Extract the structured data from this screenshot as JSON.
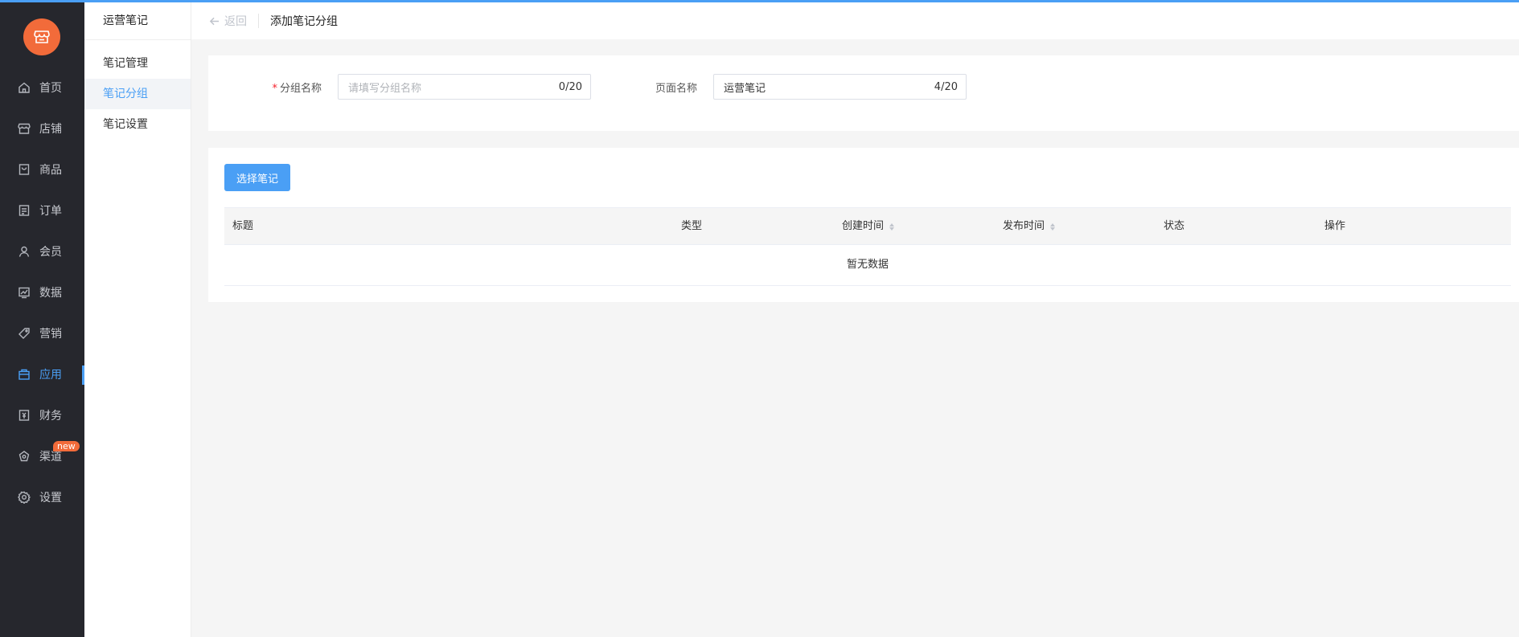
{
  "nav": {
    "items": [
      {
        "label": "首页",
        "icon": "home-icon"
      },
      {
        "label": "店铺",
        "icon": "store-icon"
      },
      {
        "label": "商品",
        "icon": "goods-icon"
      },
      {
        "label": "订单",
        "icon": "order-icon"
      },
      {
        "label": "会员",
        "icon": "member-icon"
      },
      {
        "label": "数据",
        "icon": "data-icon"
      },
      {
        "label": "营销",
        "icon": "tag-icon"
      },
      {
        "label": "应用",
        "icon": "app-icon",
        "active": true
      },
      {
        "label": "财务",
        "icon": "finance-icon"
      },
      {
        "label": "渠道",
        "icon": "channel-icon",
        "badge": "new"
      },
      {
        "label": "设置",
        "icon": "gear-icon"
      }
    ]
  },
  "subnav": {
    "title": "运营笔记",
    "items": [
      {
        "label": "笔记管理"
      },
      {
        "label": "笔记分组",
        "active": true
      },
      {
        "label": "笔记设置"
      }
    ]
  },
  "header": {
    "back_label": "返回",
    "title": "添加笔记分组"
  },
  "form": {
    "group_name": {
      "label": "分组名称",
      "required_mark": "*",
      "placeholder": "请填写分组名称",
      "value": "",
      "count": "0/20"
    },
    "page_name": {
      "label": "页面名称",
      "value": "运营笔记",
      "count": "4/20"
    }
  },
  "toolbar": {
    "select_notes_label": "选择笔记"
  },
  "table": {
    "columns": [
      {
        "label": "标题"
      },
      {
        "label": "类型"
      },
      {
        "label": "创建时间",
        "sortable": true
      },
      {
        "label": "发布时间",
        "sortable": true
      },
      {
        "label": "状态"
      },
      {
        "label": "操作"
      }
    ],
    "empty_text": "暂无数据"
  },
  "colors": {
    "accent": "#4a9ff5",
    "brand": "#f26b3a",
    "nav_bg": "#26272d"
  }
}
